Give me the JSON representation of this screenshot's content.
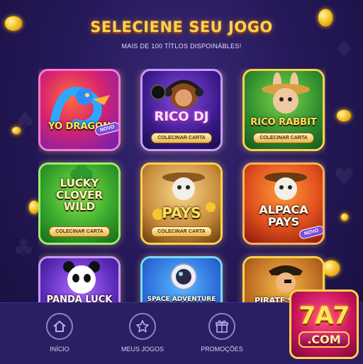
{
  "header": {
    "title": "SELECIENE SEU JOGO",
    "subtitle": "MAIS DE 100 TÍTLOS DISPOINÁBLES!"
  },
  "games": [
    {
      "name": "YO DRAGON",
      "badge": "NOVO",
      "cta": ""
    },
    {
      "name": "RICO DJ",
      "badge": "",
      "cta": "COLECINAR CARTA"
    },
    {
      "name": "RICO RABBIT",
      "badge": "",
      "cta": "COLECINAR CARTA"
    },
    {
      "name": "LUCKY CLOVER WILD",
      "badge": "",
      "cta": "COLECINAR CARTA"
    },
    {
      "name": "PAYS",
      "badge": "",
      "cta": "COLECINAR CARTA"
    },
    {
      "name": "ALPACA PAYS",
      "badge": "NOVO",
      "cta": ""
    },
    {
      "name": "PANDA LUCK",
      "badge": "",
      "cta": ""
    },
    {
      "name": "SPACE ADVENTURE",
      "badge": "",
      "cta": ""
    },
    {
      "name": "PIRATE'S TRE",
      "badge": "",
      "cta": ""
    }
  ],
  "nav": [
    {
      "label": "INÍCIO",
      "icon": "home-icon"
    },
    {
      "label": "MEUS JOGOS",
      "icon": "star-icon"
    },
    {
      "label": "PROMOÇÕES",
      "icon": "gift-icon"
    }
  ],
  "logo": {
    "main": "7A7",
    "sub": ".COM"
  },
  "colors": {
    "title": "#ffd24a",
    "accent": "#7a4fd8",
    "background": "#26195a"
  }
}
